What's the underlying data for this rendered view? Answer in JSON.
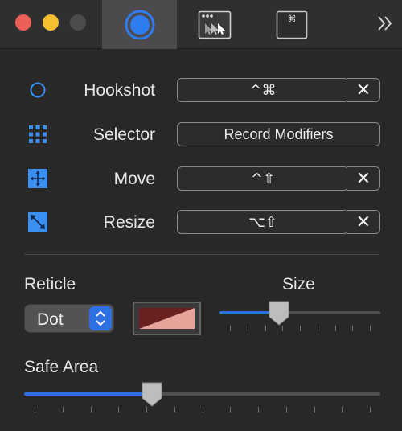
{
  "window": {
    "tabs": [
      {
        "name": "hookshot",
        "selected": true
      },
      {
        "name": "window-list",
        "selected": false
      },
      {
        "name": "shortcuts",
        "selected": false
      }
    ],
    "overflow_label": "»"
  },
  "colors": {
    "accent": "#2f6fe4",
    "icon_blue": "#3b8ff0",
    "reticle_dark": "#6b2020",
    "reticle_light": "#e6a39a"
  },
  "rows": [
    {
      "key": "hookshot",
      "label": "Hookshot",
      "shortcut": "^⌘",
      "icon": "circle-outline-icon",
      "clearable": true
    },
    {
      "key": "selector",
      "label": "Selector",
      "shortcut": "Record Modifiers",
      "icon": "grid-dots-icon",
      "clearable": false
    },
    {
      "key": "move",
      "label": "Move",
      "shortcut": "^⇧",
      "icon": "move-arrows-icon",
      "clearable": true
    },
    {
      "key": "resize",
      "label": "Resize",
      "shortcut": "⌥⇧",
      "icon": "resize-diagonal-icon",
      "clearable": true
    }
  ],
  "clear_label": "✕",
  "reticle": {
    "label": "Reticle",
    "style_value": "Dot",
    "size_label": "Size",
    "size_fraction": 0.35,
    "size_ticks": 9
  },
  "safe_area": {
    "label": "Safe Area",
    "fraction": 0.35,
    "ticks": 13
  }
}
